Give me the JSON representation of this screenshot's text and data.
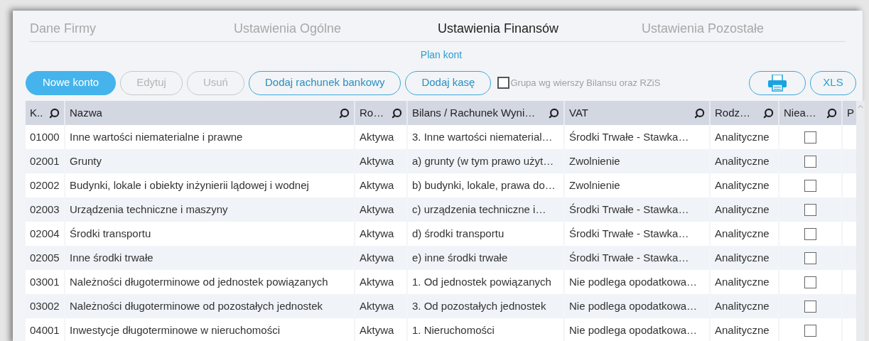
{
  "tabs": [
    {
      "label": "Dane Firmy",
      "selected": false
    },
    {
      "label": "Ustawienia Ogólne",
      "selected": false
    },
    {
      "label": "Ustawienia Finansów",
      "selected": true
    },
    {
      "label": "Ustawienia Pozostałe",
      "selected": false
    }
  ],
  "subtitle": "Plan kont",
  "toolbar": {
    "buttons": [
      {
        "label": "Nowe konto",
        "kind": "primary",
        "disabled": false
      },
      {
        "label": "Edytuj",
        "kind": "outline",
        "disabled": true
      },
      {
        "label": "Usuń",
        "kind": "outline",
        "disabled": true
      },
      {
        "label": "Dodaj rachunek bankowy",
        "kind": "outline",
        "disabled": false
      },
      {
        "label": "Dodaj kasę",
        "kind": "outline",
        "disabled": false
      }
    ],
    "group_checkbox": {
      "label": "Grupa wg wierszy Bilansu oraz RZiS",
      "checked": false
    },
    "export_buttons": [
      {
        "kind": "pdf"
      },
      {
        "kind": "text",
        "label": "XLS"
      }
    ]
  },
  "table": {
    "columns": [
      {
        "label": "K..",
        "searchable": true
      },
      {
        "label": "Nazwa",
        "searchable": true
      },
      {
        "label": "Ro…",
        "searchable": true
      },
      {
        "label": "Bilans / Rachunek Wyni…",
        "searchable": true
      },
      {
        "label": "VAT",
        "searchable": true
      },
      {
        "label": "Rodz…",
        "searchable": true
      },
      {
        "label": "Niea…",
        "searchable": true
      },
      {
        "label": "P",
        "searchable": false
      }
    ],
    "rows": [
      {
        "cells": [
          "01000",
          "Inne wartości niematerialne i prawne",
          "Aktywa",
          "3. Inne wartości niematerial…",
          "Środki Trwałe - Stawka…",
          "Analityczne"
        ],
        "checked": false
      },
      {
        "cells": [
          "02001",
          "Grunty",
          "Aktywa",
          "a) grunty (w tym prawo użyt…",
          "Zwolnienie",
          "Analityczne"
        ],
        "checked": false
      },
      {
        "cells": [
          "02002",
          "Budynki, lokale i obiekty inżynierii lądowej i wodnej",
          "Aktywa",
          "b) budynki, lokale, prawa do…",
          "Zwolnienie",
          "Analityczne"
        ],
        "checked": false
      },
      {
        "cells": [
          "02003",
          "Urządzenia techniczne i maszyny",
          "Aktywa",
          "c) urządzenia techniczne i…",
          "Środki Trwałe - Stawka…",
          "Analityczne"
        ],
        "checked": false
      },
      {
        "cells": [
          "02004",
          "Środki transportu",
          "Aktywa",
          "d) środki transportu",
          "Środki Trwałe - Stawka…",
          "Analityczne"
        ],
        "checked": false
      },
      {
        "cells": [
          "02005",
          "Inne środki trwałe",
          "Aktywa",
          "e) inne środki trwałe",
          "Środki Trwałe - Stawka…",
          "Analityczne"
        ],
        "checked": false
      },
      {
        "cells": [
          "03001",
          "Należności długoterminowe od jednostek powiązanych",
          "Aktywa",
          "1. Od jednostek powiązanych",
          "Nie podlega opodatkowa…",
          "Analityczne"
        ],
        "checked": false
      },
      {
        "cells": [
          "03002",
          "Należności długoterminowe od pozostałych jednostek",
          "Aktywa",
          "3. Od pozostałych jednostek",
          "Nie podlega opodatkowa…",
          "Analityczne"
        ],
        "checked": false
      },
      {
        "cells": [
          "04001",
          "Inwestycje długoterminowe w nieruchomości",
          "Aktywa",
          "1. Nieruchomości",
          "Nie podlega opodatkowa…",
          "Analityczne"
        ],
        "checked": false
      }
    ]
  }
}
